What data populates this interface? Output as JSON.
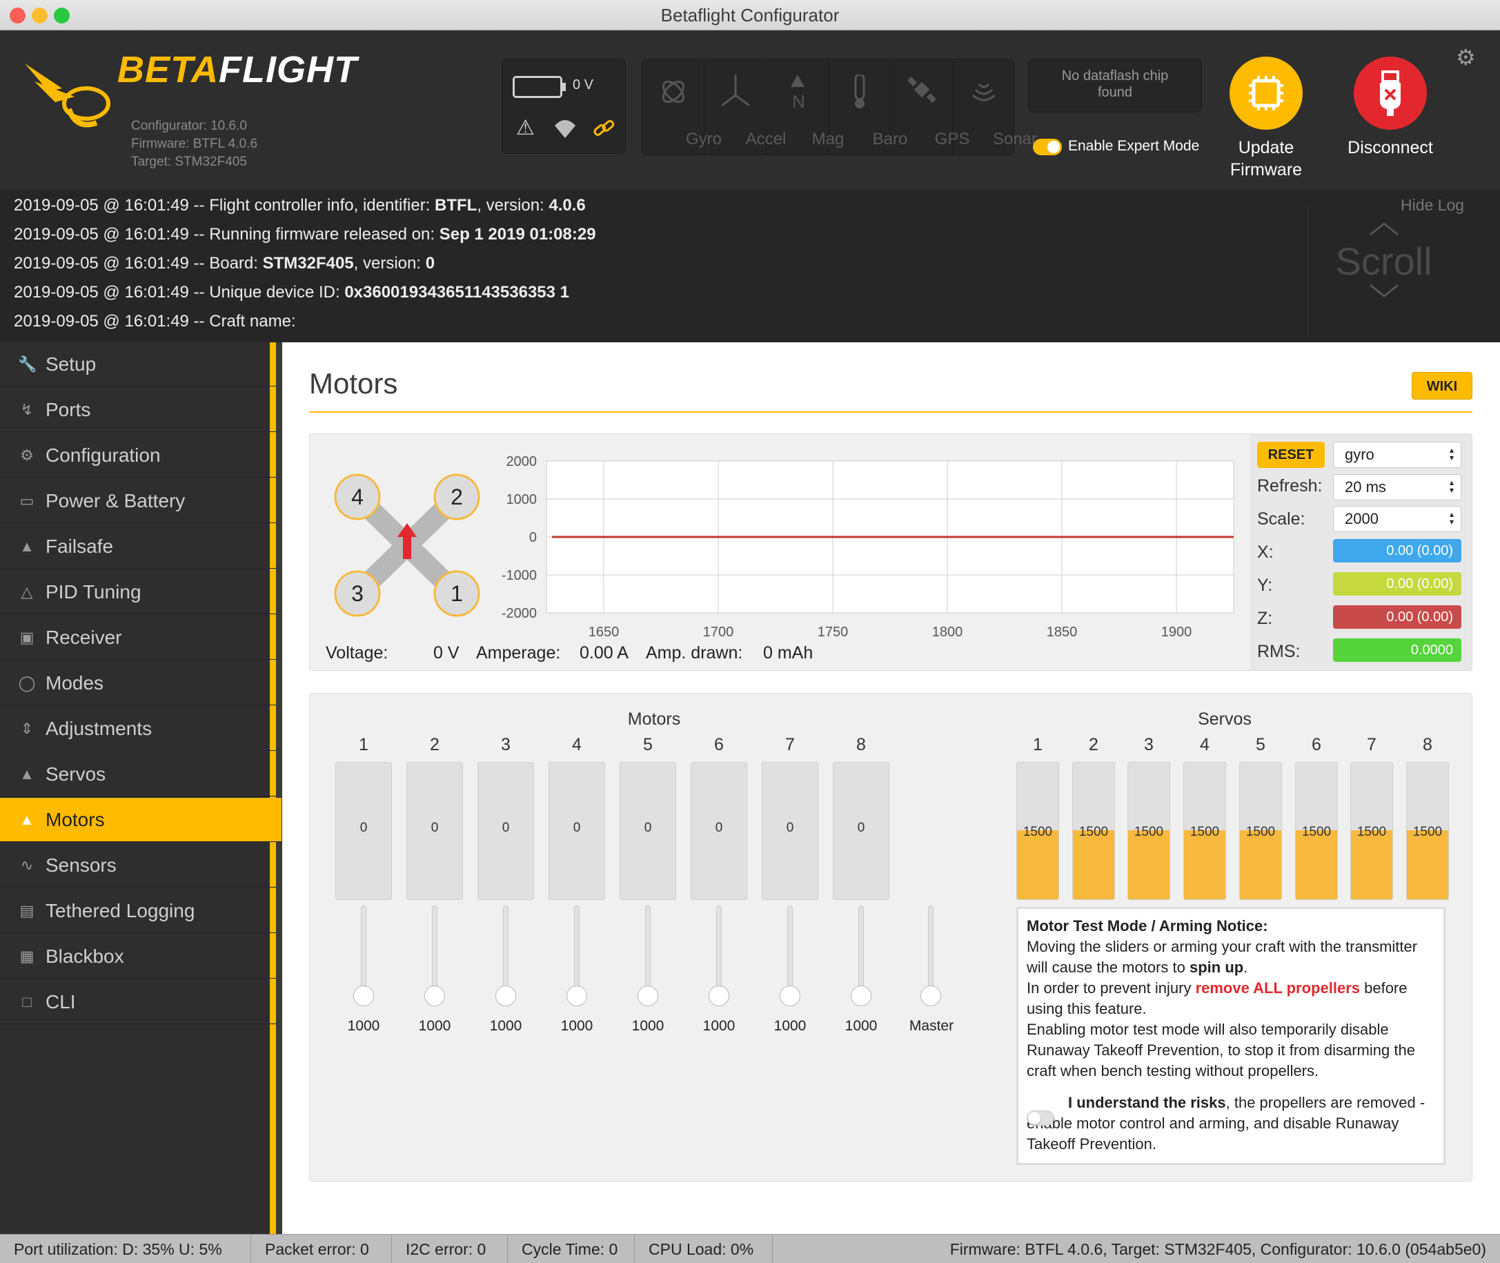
{
  "window": {
    "title": "Betaflight Configurator"
  },
  "header": {
    "logo_text_a": "BETA",
    "logo_text_b": "FLIGHT",
    "configurator_version": "Configurator: 10.6.0",
    "firmware_version": "Firmware: BTFL 4.0.6",
    "target": "Target: STM32F405",
    "battery_voltage": "0 V",
    "sensors": [
      "Gyro",
      "Accel",
      "Mag",
      "Baro",
      "GPS",
      "Sonar"
    ],
    "dataflash_status": "No dataflash chip found",
    "expert_mode_label": "Enable Expert Mode",
    "expert_mode_enabled": true,
    "update_firmware_label": "Update Firmware",
    "disconnect_label": "Disconnect"
  },
  "log": {
    "hide_label": "Hide Log",
    "scroll_label": "Scroll",
    "lines": [
      {
        "prefix": "2019-09-05 @ 16:01:49 -- Flight controller info, identifier: ",
        "b1": "BTFL",
        "mid": ", version: ",
        "b2": "4.0.6"
      },
      {
        "prefix": "2019-09-05 @ 16:01:49 -- Running firmware released on: ",
        "b1": "Sep 1 2019 01:08:29",
        "mid": "",
        "b2": ""
      },
      {
        "prefix": "2019-09-05 @ 16:01:49 -- Board: ",
        "b1": "STM32F405",
        "mid": ", version: ",
        "b2": "0"
      },
      {
        "prefix": "2019-09-05 @ 16:01:49 -- Unique device ID: ",
        "b1": "0x360019343651143536353 1",
        "mid": "",
        "b2": ""
      },
      {
        "prefix": "2019-09-05 @ 16:01:49 -- Craft name: ",
        "b1": "",
        "mid": "",
        "b2": ""
      }
    ]
  },
  "sidebar": {
    "items": [
      {
        "label": "Setup",
        "icon": "wrench-icon"
      },
      {
        "label": "Ports",
        "icon": "plug-icon"
      },
      {
        "label": "Configuration",
        "icon": "gear-icon"
      },
      {
        "label": "Power & Battery",
        "icon": "battery-icon"
      },
      {
        "label": "Failsafe",
        "icon": "parachute-icon"
      },
      {
        "label": "PID Tuning",
        "icon": "sliders-tree-icon"
      },
      {
        "label": "Receiver",
        "icon": "receiver-icon"
      },
      {
        "label": "Modes",
        "icon": "toggles-icon"
      },
      {
        "label": "Adjustments",
        "icon": "adjust-icon"
      },
      {
        "label": "Servos",
        "icon": "servo-icon"
      },
      {
        "label": "Motors",
        "icon": "motor-icon"
      },
      {
        "label": "Sensors",
        "icon": "pulse-icon"
      },
      {
        "label": "Tethered Logging",
        "icon": "tether-icon"
      },
      {
        "label": "Blackbox",
        "icon": "blackbox-icon"
      },
      {
        "label": "CLI",
        "icon": "terminal-icon"
      }
    ],
    "active": "Motors"
  },
  "main": {
    "title": "Motors",
    "wiki_label": "WIKI",
    "quad_motor_numbers": [
      "4",
      "2",
      "3",
      "1"
    ],
    "telemetry": {
      "voltage_label": "Voltage:",
      "voltage_value": "0 V",
      "amperage_label": "Amperage:",
      "amperage_value": "0.00 A",
      "drawn_label": "Amp. drawn:",
      "drawn_value": "0 mAh"
    },
    "graph_controls": {
      "reset_label": "RESET",
      "source_selected": "gyro",
      "refresh_label": "Refresh:",
      "refresh_selected": "20 ms",
      "scale_label": "Scale:",
      "scale_selected": "2000",
      "x_label": "X:",
      "x_value": "0.00 (0.00)",
      "y_label": "Y:",
      "y_value": "0.00 (0.00)",
      "z_label": "Z:",
      "z_value": "0.00 (0.00)",
      "rms_label": "RMS:",
      "rms_value": "0.0000"
    },
    "motors_header": "Motors",
    "servos_header": "Servos",
    "motors": [
      {
        "n": "1",
        "value": "0",
        "slider": "1000"
      },
      {
        "n": "2",
        "value": "0",
        "slider": "1000"
      },
      {
        "n": "3",
        "value": "0",
        "slider": "1000"
      },
      {
        "n": "4",
        "value": "0",
        "slider": "1000"
      },
      {
        "n": "5",
        "value": "0",
        "slider": "1000"
      },
      {
        "n": "6",
        "value": "0",
        "slider": "1000"
      },
      {
        "n": "7",
        "value": "0",
        "slider": "1000"
      },
      {
        "n": "8",
        "value": "0",
        "slider": "1000"
      }
    ],
    "master_label": "Master",
    "servos": [
      {
        "n": "1",
        "value": "1500"
      },
      {
        "n": "2",
        "value": "1500"
      },
      {
        "n": "3",
        "value": "1500"
      },
      {
        "n": "4",
        "value": "1500"
      },
      {
        "n": "5",
        "value": "1500"
      },
      {
        "n": "6",
        "value": "1500"
      },
      {
        "n": "7",
        "value": "1500"
      },
      {
        "n": "8",
        "value": "1500"
      }
    ],
    "notice": {
      "title": "Motor Test Mode / Arming Notice:",
      "p1a": "Moving the sliders or arming your craft with the transmitter will cause the motors to ",
      "p1b": "spin up",
      "p1c": ".",
      "p2a": "In order to prevent injury ",
      "p2b": "remove ALL propellers",
      "p2c": " before using this feature.",
      "p3": "Enabling motor test mode will also temporarily disable Runaway Takeoff Prevention, to stop it from disarming the craft when bench testing without propellers.",
      "risk_b": "I understand the risks",
      "risk_rest": ", the propellers are removed - enable motor control and arming, and disable Runaway Takeoff Prevention."
    }
  },
  "chart_data": {
    "type": "line",
    "x_ticks": [
      1650,
      1700,
      1750,
      1800,
      1850,
      1900
    ],
    "y_ticks": [
      2000,
      1000,
      0,
      -1000,
      -2000
    ],
    "xlim": [
      1625,
      1925
    ],
    "ylim": [
      -2000,
      2000
    ],
    "series": [
      {
        "values_constant": 0,
        "color": "#c0392b"
      }
    ]
  },
  "statusbar": {
    "port_util": "Port utilization: D: 35% U: 5%",
    "packet_error": "Packet error: 0",
    "i2c_error": "I2C error: 0",
    "cycle_time": "Cycle Time: 0",
    "cpu_load": "CPU Load: 0%",
    "firmware_info": "Firmware: BTFL 4.0.6, Target: STM32F405, Configurator: 10.6.0 (054ab5e0)"
  },
  "colors": {
    "accent": "#ffbb00",
    "danger": "#e2282e",
    "x_axis": "#3fa8ec",
    "y_axis": "#c5d93f",
    "z_axis": "#c94a4a",
    "rms": "#55d43b"
  }
}
